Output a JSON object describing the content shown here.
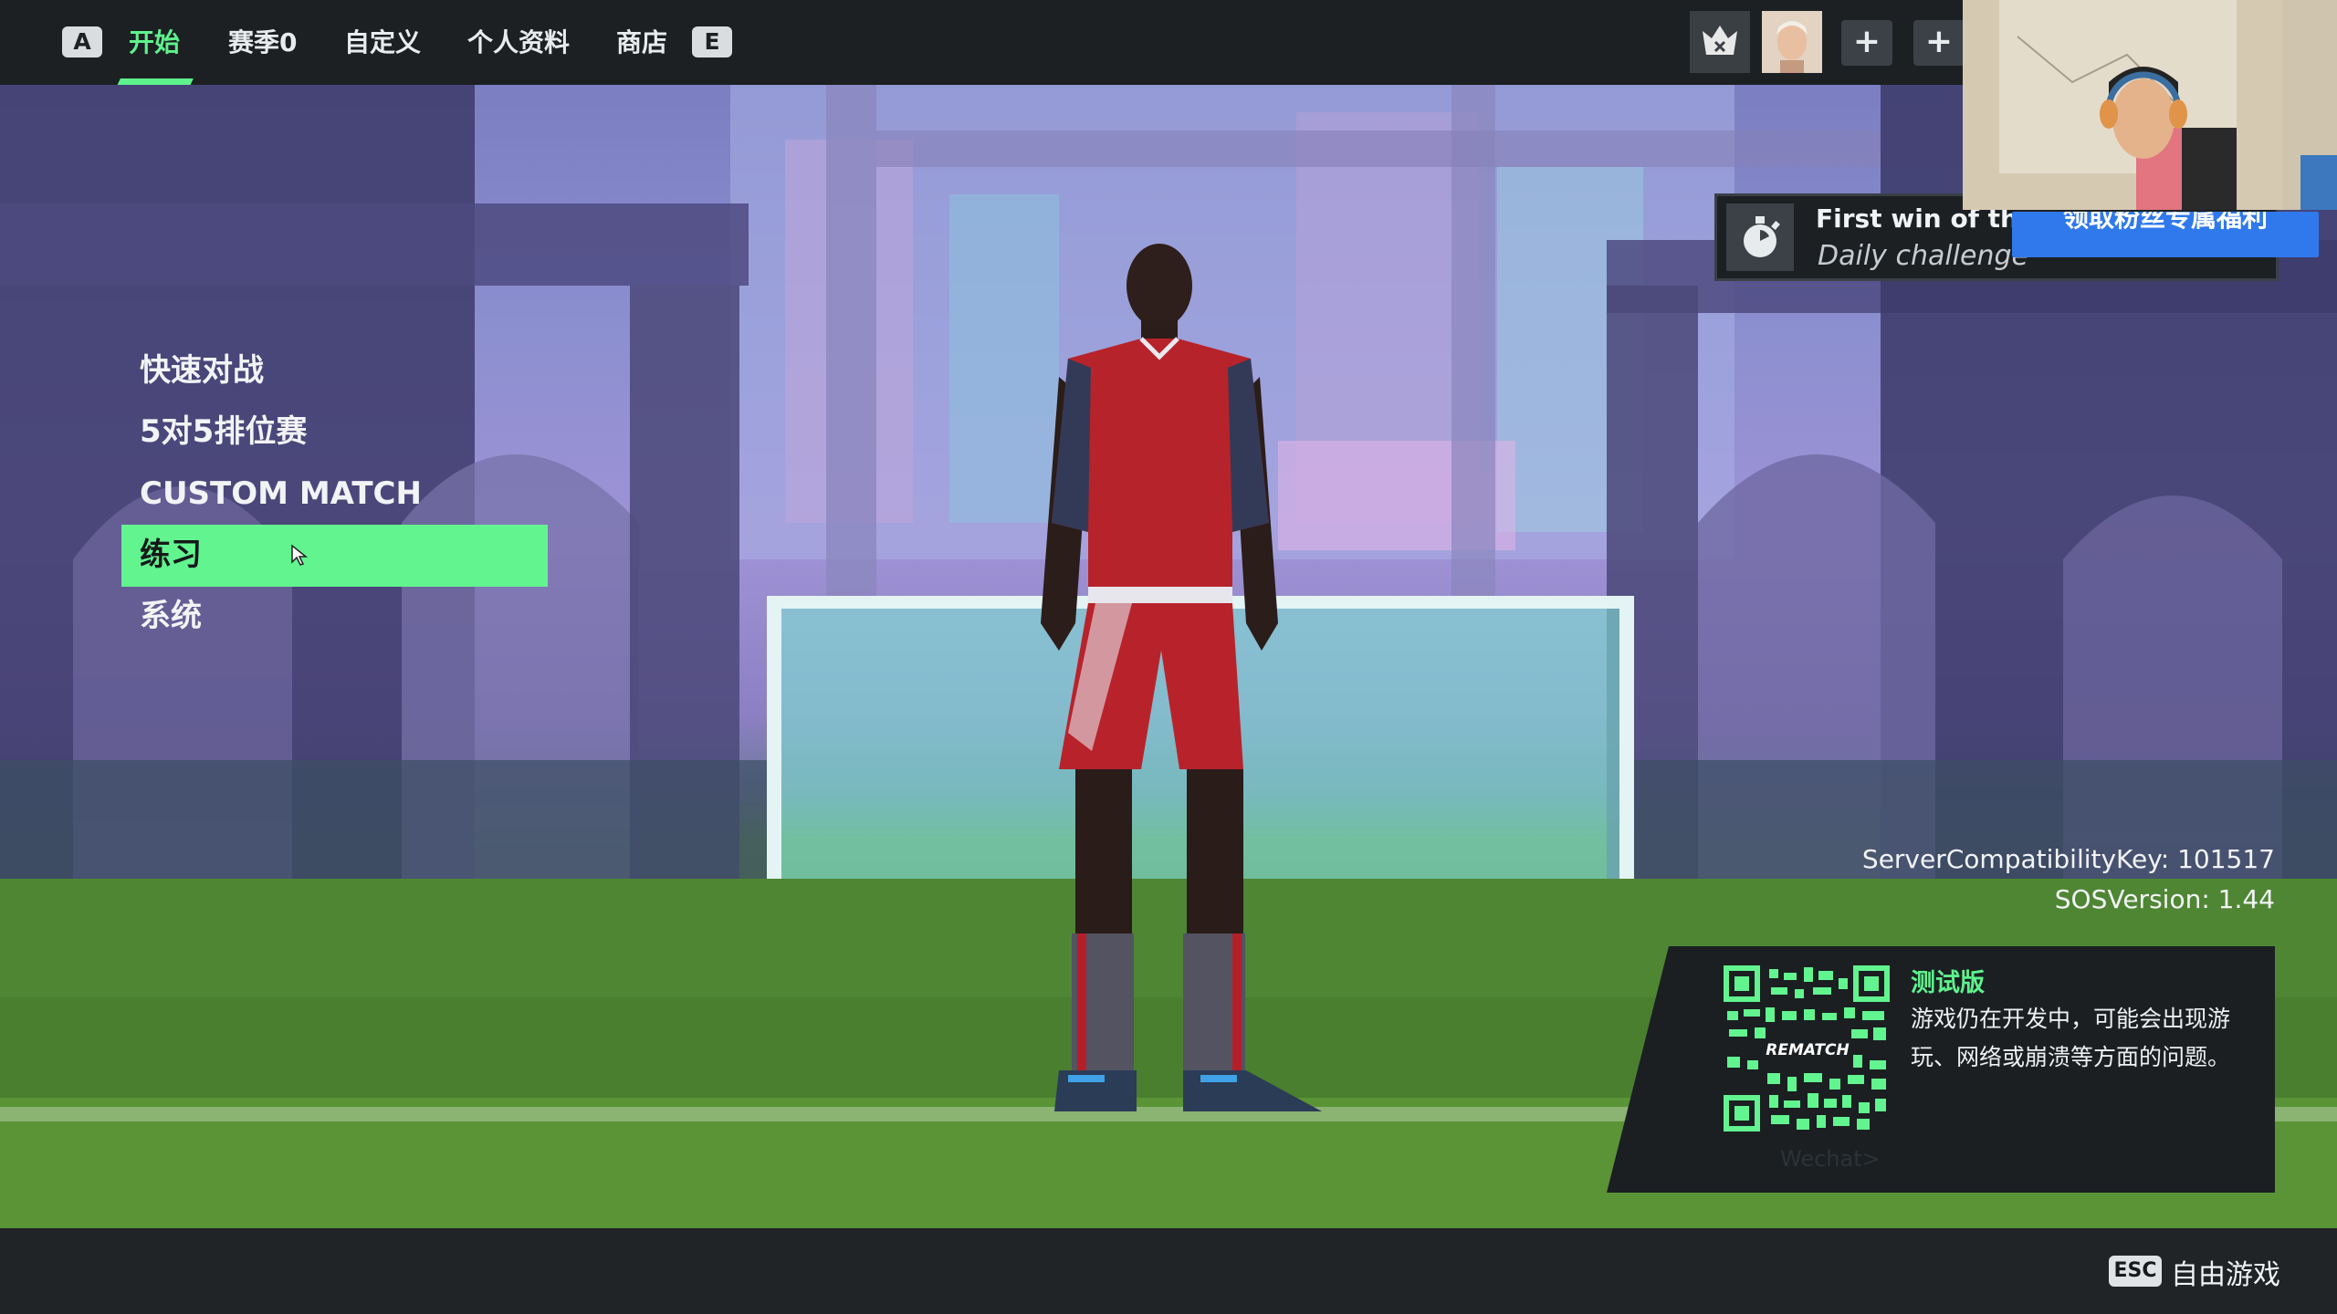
{
  "topbar": {
    "key_left": "A",
    "key_right": "E",
    "tabs": [
      {
        "label": "开始",
        "active": true
      },
      {
        "label": "赛季0",
        "active": false
      },
      {
        "label": "自定义",
        "active": false
      },
      {
        "label": "个人资料",
        "active": false
      },
      {
        "label": "商店",
        "active": false
      }
    ],
    "party_slots": [
      {
        "icon": "player-emblem-icon"
      },
      {
        "icon": "player-avatar-icon"
      },
      {
        "icon": "add-friend-icon",
        "label": "+"
      },
      {
        "icon": "add-friend-icon",
        "label": "+"
      }
    ]
  },
  "menu": {
    "items": [
      {
        "label": "快速对战",
        "selected": false
      },
      {
        "label": "5对5排位赛",
        "selected": false
      },
      {
        "label": "CUSTOM MATCH",
        "selected": false
      },
      {
        "label": "练习",
        "selected": true
      },
      {
        "label": "系统",
        "selected": false
      }
    ]
  },
  "challenge": {
    "title": "First win of the d",
    "subtitle": "Daily challenge",
    "icon": "stopwatch-icon"
  },
  "promo_banner": {
    "text": "领取粉丝专属福利"
  },
  "version": {
    "compat_key": "ServerCompatibilityKey: 101517",
    "sos_version": "SOSVersion: 1.44"
  },
  "test_panel": {
    "title": "测试版",
    "body": "游戏仍在开发中，可能会出现游玩、网络或崩溃等方面的问题。",
    "qr_logo": "REMATCH",
    "faded_label": "Wechat>"
  },
  "footer": {
    "key": "ESC",
    "label": "自由游戏"
  },
  "colors": {
    "accent": "#62f48f",
    "bar_bg": "#1c2023",
    "promo_blue": "#2f79ec"
  }
}
